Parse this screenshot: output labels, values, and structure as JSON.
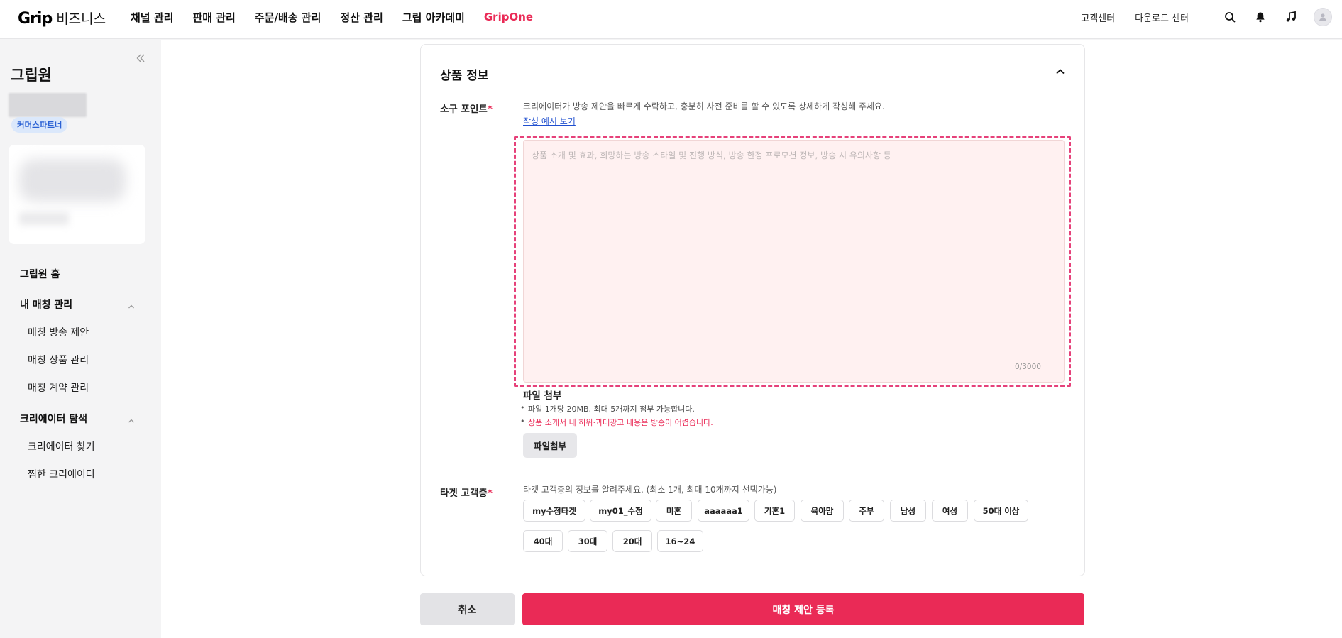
{
  "header": {
    "logo_brand": "Grip",
    "logo_suffix": "비즈니스",
    "nav": [
      "채널 관리",
      "판매 관리",
      "주문/배송 관리",
      "정산 관리",
      "그립 아카데미",
      "GripOne"
    ],
    "right_links": [
      "고객센터",
      "다운로드 센터"
    ],
    "accent_color": "#ea2a56"
  },
  "sidebar": {
    "title": "그립원",
    "badge": "커머스파트너",
    "menu": {
      "home": "그립원 홈",
      "matching_group": "내 매칭 관리",
      "matching_items": [
        "매칭 방송 제안",
        "매칭 상품 관리",
        "매칭 계약 관리"
      ],
      "creator_group": "크리에이터 탐색",
      "creator_items": [
        "크리에이터 찾기",
        "찜한 크리에이터"
      ]
    }
  },
  "section": {
    "title": "상품 정보",
    "appeal": {
      "label": "소구 포인트",
      "required": "*",
      "help": "크리에이터가 방송 제안을 빠르게 수락하고, 충분히 사전 준비를 할 수 있도록 상세하게 작성해 주세요.",
      "example_link": "작성 예시 보기",
      "placeholder": "상품 소개 및 효과, 희망하는 방송 스타일 및 진행 방식, 방송 한정 프로모션 정보, 방송 시 유의사항 등",
      "value": "",
      "counter": "0/3000"
    },
    "file": {
      "title": "파일 첨부",
      "note": "파일 1개당 20MB, 최대 5개까지 첨부 가능합니다.",
      "warning": "상품 소개서 내 허위·과대광고 내용은 방송이 어렵습니다.",
      "button": "파일첨부"
    },
    "target": {
      "label": "타겟 고객층",
      "required": "*",
      "help": "타겟 고객층의 정보를 알려주세요. (최소 1개, 최대 10개까지 선택가능)",
      "chips_row1": [
        "my수정타겟",
        "my01_수정",
        "미혼",
        "aaaaaa1",
        "기혼1",
        "육아맘",
        "주부",
        "남성",
        "여성",
        "50대 이상"
      ],
      "chips_row2": [
        "40대",
        "30대",
        "20대",
        "16~24"
      ]
    }
  },
  "footer": {
    "cancel": "취소",
    "submit": "매칭 제안 등록"
  }
}
